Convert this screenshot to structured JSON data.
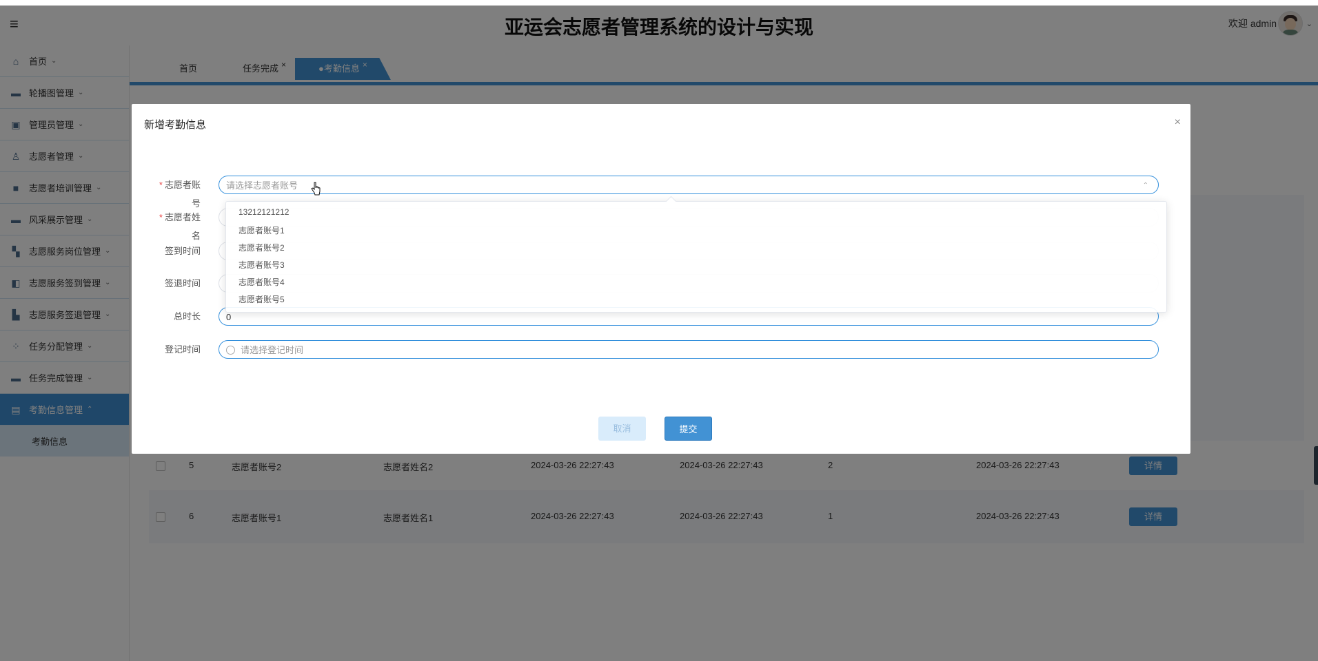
{
  "app": {
    "title": "亚运会志愿者管理系统的设计与实现"
  },
  "header": {
    "welcome": "欢迎 admin",
    "menu_icon": "menu-icon",
    "avatar_caret": "⌄"
  },
  "sidebar": {
    "items": [
      {
        "label": "首页",
        "icon": "home-icon"
      },
      {
        "label": "轮播图管理",
        "icon": "carousel-icon"
      },
      {
        "label": "管理员管理",
        "icon": "admin-icon"
      },
      {
        "label": "志愿者管理",
        "icon": "user-icon"
      },
      {
        "label": "志愿者培训管理",
        "icon": "book-icon"
      },
      {
        "label": "风采展示管理",
        "icon": "image-icon"
      },
      {
        "label": "志愿服务岗位管理",
        "icon": "grid-icon"
      },
      {
        "label": "志愿服务签到管理",
        "icon": "checkin-icon"
      },
      {
        "label": "志愿服务签退管理",
        "icon": "checkout-icon"
      },
      {
        "label": "任务分配管理",
        "icon": "apps-icon"
      },
      {
        "label": "任务完成管理",
        "icon": "task-icon"
      },
      {
        "label": "考勤信息管理",
        "icon": "attendance-icon",
        "active": true
      }
    ],
    "sub_item": "考勤信息"
  },
  "tabs": [
    {
      "label": "首页"
    },
    {
      "label": "任务完成",
      "close": "×"
    },
    {
      "label": "●考勤信息",
      "close": "×",
      "active": true
    }
  ],
  "table": {
    "rows": [
      {
        "index": "5",
        "account": "志愿者账号2",
        "name": "志愿者姓名2",
        "sign_in": "2024-03-26 22:27:43",
        "sign_out": "2024-03-26 22:27:43",
        "duration": "2",
        "register_time": "2024-03-26 22:27:43",
        "action": "详情"
      },
      {
        "index": "6",
        "account": "志愿者账号1",
        "name": "志愿者姓名1",
        "sign_in": "2024-03-26 22:27:43",
        "sign_out": "2024-03-26 22:27:43",
        "duration": "1",
        "register_time": "2024-03-26 22:27:43",
        "action": "详情"
      }
    ]
  },
  "dialog": {
    "title": "新增考勤信息",
    "close": "×",
    "fields": {
      "account": {
        "label_line1": "志愿者账",
        "label_line2": "号",
        "placeholder": "请选择志愿者账号"
      },
      "name": {
        "label_line1": "志愿者姓",
        "label_line2": "名"
      },
      "sign_in": {
        "label": "签到时间"
      },
      "sign_out": {
        "label": "签退时间"
      },
      "duration": {
        "label": "总时长",
        "value": "0"
      },
      "register": {
        "label": "登记时间",
        "placeholder": "请选择登记时间"
      }
    },
    "dropdown_options": [
      "13212121212",
      "志愿者账号1",
      "志愿者账号2",
      "志愿者账号3",
      "志愿者账号4",
      "志愿者账号5"
    ],
    "buttons": {
      "cancel": "取消",
      "submit": "提交"
    }
  },
  "colors": {
    "primary": "#4292d4",
    "active_nav": "#3f8fd2",
    "required": "#e84a4a"
  }
}
